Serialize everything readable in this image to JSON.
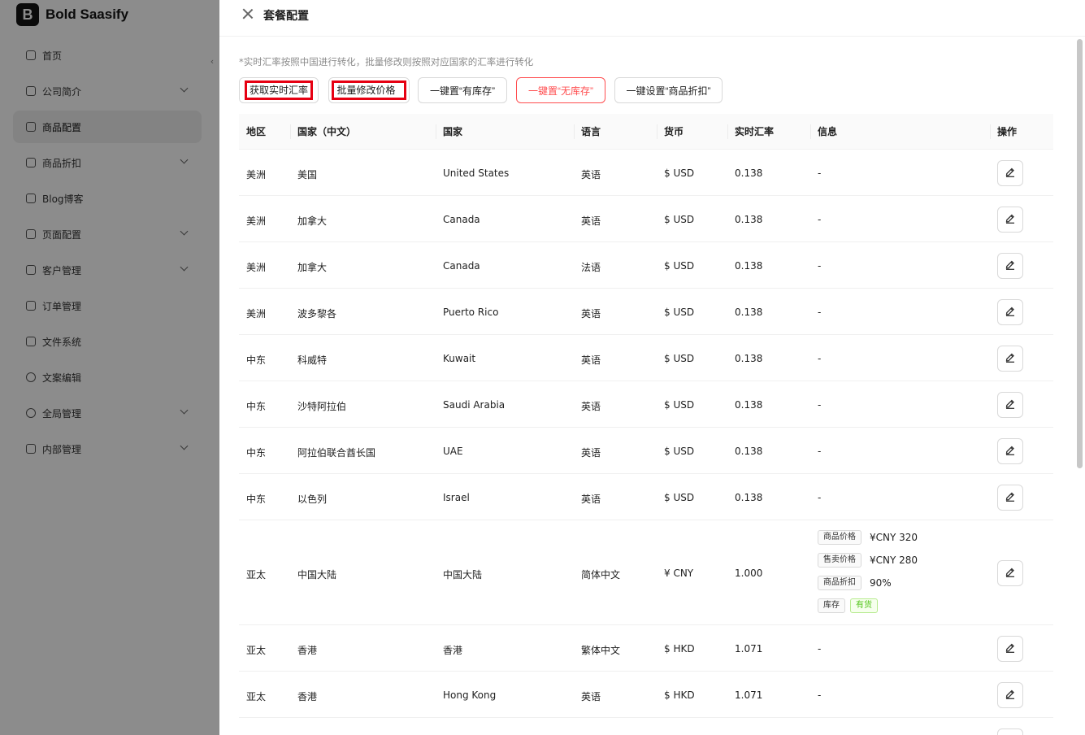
{
  "app": {
    "logo_letter": "B",
    "name": "Bold Saasify"
  },
  "sidebar": {
    "collapse_glyph": "‹",
    "items": [
      {
        "label": "首页",
        "icon": "home-icon",
        "has_children": false,
        "active": false
      },
      {
        "label": "公司简介",
        "icon": "building-icon",
        "has_children": true,
        "active": false
      },
      {
        "label": "商品配置",
        "icon": "box-icon",
        "has_children": false,
        "active": true
      },
      {
        "label": "商品折扣",
        "icon": "tag-icon",
        "has_children": true,
        "active": false
      },
      {
        "label": "Blog博客",
        "icon": "users-icon",
        "has_children": false,
        "active": false
      },
      {
        "label": "页面配置",
        "icon": "monitor-icon",
        "has_children": true,
        "active": false
      },
      {
        "label": "客户管理",
        "icon": "customers-icon",
        "has_children": true,
        "active": false
      },
      {
        "label": "订单管理",
        "icon": "order-icon",
        "has_children": false,
        "active": false
      },
      {
        "label": "文件系统",
        "icon": "file-icon",
        "has_children": false,
        "active": false
      },
      {
        "label": "文案编辑",
        "icon": "globe-icon",
        "has_children": false,
        "active": false
      },
      {
        "label": "全局管理",
        "icon": "dollar-icon",
        "has_children": true,
        "active": false
      },
      {
        "label": "内部管理",
        "icon": "user-icon",
        "has_children": true,
        "active": false
      }
    ]
  },
  "drawer": {
    "title": "套餐配置",
    "note": "*实时汇率按照中国进行转化，批量修改则按照对应国家的汇率进行转化",
    "buttons": {
      "fetch_rate": "获取实时汇率",
      "batch_edit": "批量修改价格",
      "set_in_stock": "一键置“有库存”",
      "set_out_of_stock": "一键置“无库存”",
      "set_discount": "一键设置“商品折扣”"
    }
  },
  "table": {
    "columns": {
      "region": "地区",
      "country_cn": "国家（中文）",
      "country": "国家",
      "language": "语言",
      "currency": "货币",
      "rate": "实时汇率",
      "info": "信息",
      "action": "操作"
    },
    "rows": [
      {
        "region": "美洲",
        "country_cn": "美国",
        "country": "United States",
        "language": "英语",
        "currency": "$ USD",
        "rate": "0.138",
        "info": "-"
      },
      {
        "region": "美洲",
        "country_cn": "加拿大",
        "country": "Canada",
        "language": "英语",
        "currency": "$ USD",
        "rate": "0.138",
        "info": "-"
      },
      {
        "region": "美洲",
        "country_cn": "加拿大",
        "country": "Canada",
        "language": "法语",
        "currency": "$ USD",
        "rate": "0.138",
        "info": "-"
      },
      {
        "region": "美洲",
        "country_cn": "波多黎各",
        "country": "Puerto Rico",
        "language": "英语",
        "currency": "$ USD",
        "rate": "0.138",
        "info": "-"
      },
      {
        "region": "中东",
        "country_cn": "科威特",
        "country": "Kuwait",
        "language": "英语",
        "currency": "$ USD",
        "rate": "0.138",
        "info": "-"
      },
      {
        "region": "中东",
        "country_cn": "沙特阿拉伯",
        "country": "Saudi Arabia",
        "language": "英语",
        "currency": "$ USD",
        "rate": "0.138",
        "info": "-"
      },
      {
        "region": "中东",
        "country_cn": "阿拉伯联合酋长国",
        "country": "UAE",
        "language": "英语",
        "currency": "$ USD",
        "rate": "0.138",
        "info": "-"
      },
      {
        "region": "中东",
        "country_cn": "以色列",
        "country": "Israel",
        "language": "英语",
        "currency": "$ USD",
        "rate": "0.138",
        "info": "-"
      },
      {
        "region": "亚太",
        "country_cn": "中国大陆",
        "country": "中国大陆",
        "language": "简体中文",
        "currency": "¥ CNY",
        "rate": "1.000",
        "info": null,
        "details": [
          {
            "label": "商品价格",
            "value": "¥CNY 320"
          },
          {
            "label": "售卖价格",
            "value": "¥CNY 280"
          },
          {
            "label": "商品折扣",
            "value": "90%"
          },
          {
            "label": "库存",
            "status": "有货"
          }
        ]
      },
      {
        "region": "亚太",
        "country_cn": "香港",
        "country": "香港",
        "language": "繁体中文",
        "currency": "$ HKD",
        "rate": "1.071",
        "info": "-"
      },
      {
        "region": "亚太",
        "country_cn": "香港",
        "country": "Hong Kong",
        "language": "英语",
        "currency": "$ HKD",
        "rate": "1.071",
        "info": "-"
      },
      {
        "region": "",
        "country_cn": "",
        "country": "",
        "language": "",
        "currency": "",
        "rate": "",
        "info": ""
      }
    ]
  },
  "colors": {
    "danger": "#ff4d4f",
    "highlight": "#e60012",
    "success": "#52c41a"
  }
}
